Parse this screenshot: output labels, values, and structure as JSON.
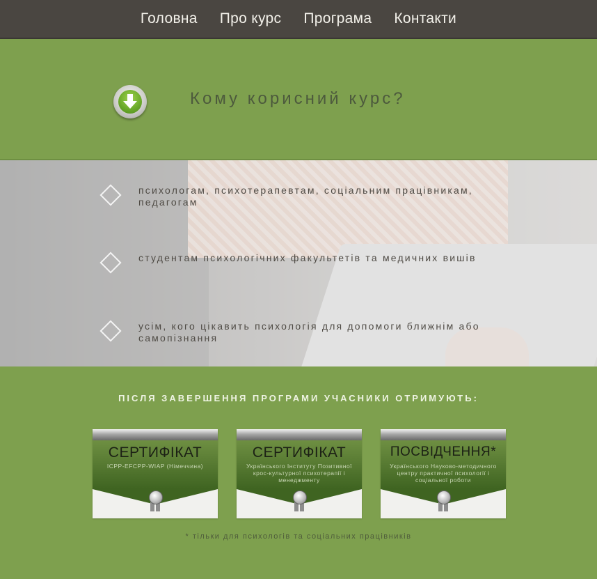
{
  "nav": {
    "items": [
      "Головна",
      "Про курс",
      "Програма",
      "Контакти"
    ]
  },
  "hero": {
    "title": "Кому корисний курс?",
    "icon": "down-arrow-icon"
  },
  "audience": {
    "items": [
      "психологам, психотерапевтам, соціальним працівникам, педагогам",
      "студентам психологічних факультетів та медичних вишів",
      "усім, кого цікавить психологія для допомоги ближнім або самопізнання"
    ]
  },
  "certificates": {
    "heading": "ПІСЛЯ ЗАВЕРШЕННЯ ПРОГРАМИ УЧАСНИКИ ОТРИМУЮТЬ:",
    "cards": [
      {
        "title": "СЕРТИФІКАТ",
        "subtitle": "ICPP-EFCPP-WIAP (Німеччина)"
      },
      {
        "title": "СЕРТИФІКАТ",
        "subtitle": "Українського Інституту Позитивної крос-культурної психотерапії і менеджменту"
      },
      {
        "title": "ПОСВІДЧЕННЯ*",
        "subtitle": "Українського Науково-методичного центру практичної психології і соціальної роботи"
      }
    ],
    "note": "* тільки для психологів та соціальних працівників"
  },
  "colors": {
    "green": "#7ea04e",
    "nav": "#4a4641"
  }
}
